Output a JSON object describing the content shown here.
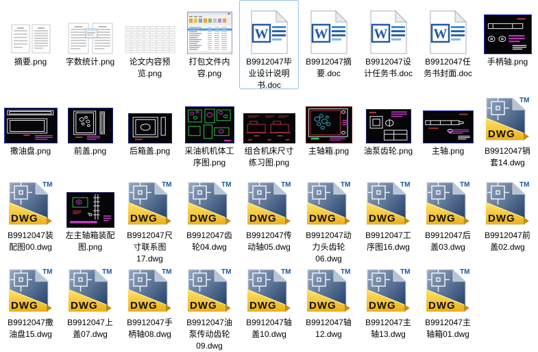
{
  "window": {
    "background": "#ffffff"
  },
  "colors": {
    "selection_border": "#9abfe2",
    "selection_fill": "#fdfeff",
    "label_text": "#000000",
    "word_blue": "#2458a8",
    "word_line_light": "#3f8fd0",
    "word_line_dark": "#2a62a8",
    "dwg_sheet_blue_top": "#96a8c0",
    "dwg_sheet_blue_bottom": "#1c3a66",
    "dwg_yellow_top": "#ffe26a",
    "dwg_yellow_bottom": "#eab119",
    "dwg_trademark_blue": "#1857a0",
    "cad_background": "#060609"
  },
  "icon_labels": {
    "dwg_text": "DWG",
    "trademark": "TM",
    "word_logo": "W"
  },
  "files": [
    {
      "name": "摘要.png",
      "icon": "thumb-abstract",
      "selected": false
    },
    {
      "name": "字数统计.png",
      "icon": "thumb-word-count",
      "selected": false
    },
    {
      "name": "论文内容预览.png",
      "icon": "thumb-preview-grid",
      "selected": false
    },
    {
      "name": "打包文件内容.png",
      "icon": "thumb-archive-window",
      "selected": false
    },
    {
      "name": "B9912047毕业设计说明书.doc",
      "icon": "word-doc",
      "selected": true
    },
    {
      "name": "B9912047摘要.doc",
      "icon": "word-doc",
      "selected": false
    },
    {
      "name": "B9912047设计任务书.doc",
      "icon": "word-doc",
      "selected": false
    },
    {
      "name": "B9912047任务书封面.doc",
      "icon": "word-doc",
      "selected": false
    },
    {
      "name": "手柄轴.png",
      "icon": "cad-handle-shaft",
      "selected": false
    },
    {
      "name": "撒油盘.png",
      "icon": "cad-oil-pan",
      "selected": false
    },
    {
      "name": "前盖.png",
      "icon": "cad-front-cover",
      "selected": false
    },
    {
      "name": "后箱盖.png",
      "icon": "cad-rear-box-cover",
      "selected": false
    },
    {
      "name": "采油机机体工序图.png",
      "icon": "cad-process-plan",
      "selected": false
    },
    {
      "name": "组合机床尺寸练习图.png",
      "icon": "cad-machine-practice",
      "selected": false
    },
    {
      "name": "主轴箱.png",
      "icon": "cad-spindle-box",
      "selected": false
    },
    {
      "name": "油泵齿轮.png",
      "icon": "cad-pump-gear",
      "selected": false
    },
    {
      "name": "主轴.png",
      "icon": "cad-spindle",
      "selected": false
    },
    {
      "name": "B9912047销套14.dwg",
      "icon": "dwg-file",
      "selected": false
    },
    {
      "name": "B9912047装配图00.dwg",
      "icon": "dwg-file",
      "selected": false
    },
    {
      "name": "左主轴箱装配图.png",
      "icon": "cad-left-spindle-box",
      "selected": false
    },
    {
      "name": "B9912047尺寸联系图17.dwg",
      "icon": "dwg-file",
      "selected": false
    },
    {
      "name": "B9912047齿轮04.dwg",
      "icon": "dwg-file",
      "selected": false
    },
    {
      "name": "B9912047传动轴05.dwg",
      "icon": "dwg-file",
      "selected": false
    },
    {
      "name": "B9912047动力头齿轮06.dwg",
      "icon": "dwg-file",
      "selected": false
    },
    {
      "name": "B9912047工序图16.dwg",
      "icon": "dwg-file",
      "selected": false
    },
    {
      "name": "B9912047后盖03.dwg",
      "icon": "dwg-file",
      "selected": false
    },
    {
      "name": "B9912047前盖02.dwg",
      "icon": "dwg-file",
      "selected": false
    },
    {
      "name": "B9912047撒油盘15.dwg",
      "icon": "dwg-file",
      "selected": false
    },
    {
      "name": "B9912047上盖07.dwg",
      "icon": "dwg-file",
      "selected": false
    },
    {
      "name": "B9912047手柄轴08.dwg",
      "icon": "dwg-file",
      "selected": false
    },
    {
      "name": "B9912047油泵传动齿轮09.dwg",
      "icon": "dwg-file",
      "selected": false
    },
    {
      "name": "B9912047轴盖10.dwg",
      "icon": "dwg-file",
      "selected": false
    },
    {
      "name": "B9912047轴12.dwg",
      "icon": "dwg-file",
      "selected": false
    },
    {
      "name": "B9912047主轴13.dwg",
      "icon": "dwg-file",
      "selected": false
    },
    {
      "name": "B9912047主轴箱01.dwg",
      "icon": "dwg-file",
      "selected": false
    }
  ]
}
